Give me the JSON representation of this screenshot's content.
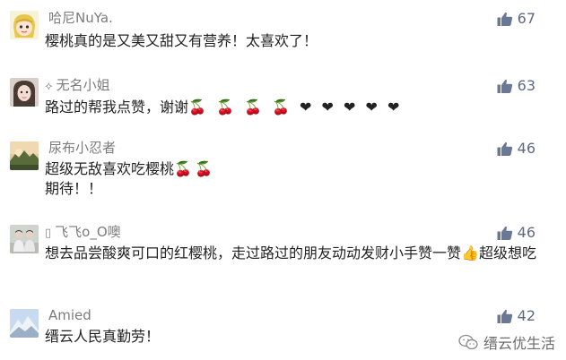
{
  "comments": [
    {
      "prefix": "",
      "nickname": "哈尼NuYa.",
      "text": "樱桃真的是又美又甜又有营养！太喜欢了！",
      "emoji": "",
      "text2": "",
      "likes": "67",
      "avatar": "cartoon-girl-avatar"
    },
    {
      "prefix": "⟡",
      "nickname": "无名小姐",
      "text": "路过的帮我点赞，谢谢",
      "emoji": "🍒 🍒 🍒 🍒 ❤ ❤ ❤ ❤ ❤",
      "text2": "",
      "likes": "63",
      "avatar": "woman-portrait-avatar"
    },
    {
      "prefix": "",
      "nickname": "尿布小忍者",
      "text": "超级无敌喜欢吃樱桃",
      "emoji": "🍒🍒",
      "text2": "期待！！",
      "likes": "46",
      "avatar": "sunset-landscape-avatar"
    },
    {
      "prefix": "▯",
      "nickname": "飞飞o_O噢",
      "text": "想去品尝酸爽可口的红樱桃，走过路过的朋友动动发财小手赞一赞",
      "emoji": "👍",
      "text2": "超级想吃",
      "likes": "46",
      "avatar": "two-people-avatar"
    },
    {
      "prefix": "",
      "nickname": "Amied",
      "text": "缙云人民真勤劳！",
      "emoji": "",
      "text2": "",
      "likes": "42",
      "avatar": "snow-mountain-avatar"
    }
  ],
  "watermark": {
    "text": "缙云优生活",
    "icon": "wechat-icon"
  },
  "colors": {
    "nickname": "#7b7b7b",
    "content": "#222222",
    "like": "#5d6a84",
    "background": "#ffffff"
  }
}
